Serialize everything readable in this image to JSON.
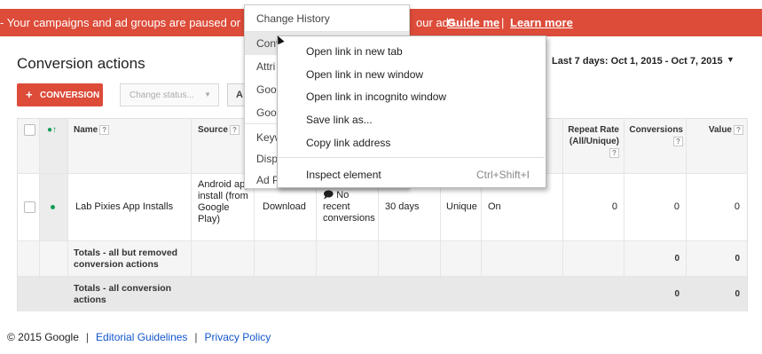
{
  "banner": {
    "text_left": "- Your campaigns and ad groups are paused or remov",
    "text_right": "our ads.",
    "guide_me": "Guide me",
    "separator": "|",
    "learn_more": "Learn more",
    "color": "#dd4b39"
  },
  "page": {
    "title": "Conversion actions",
    "date_range": "Last 7 days: Oct 1, 2015 - Oct 7, 2015",
    "date_icon": "caret-down-icon"
  },
  "toolbar": {
    "add_label": "CONVERSION",
    "add_icon": "+",
    "status_dropdown": "Change status...",
    "status_icon": "caret-down-icon",
    "partial_button": "A"
  },
  "table": {
    "headers": {
      "name": "Name",
      "source": "Source",
      "repeat_rate": "Repeat Rate (All/Unique)",
      "conversions": "Conversions",
      "value": "Value",
      "help": "?"
    },
    "rows": [
      {
        "name": "Lab Pixies App Installs",
        "source": "Android app install (from Google Play)",
        "category": "Download",
        "tracking_status": "No recent conversions",
        "status_icon": "comment-icon",
        "window": "30 days",
        "counting": "Unique",
        "include": "On",
        "repeat_rate": "0",
        "conversions": "0",
        "value": "0"
      }
    ],
    "totals": [
      {
        "label": "Totals - all but removed conversion actions",
        "conversions": "0",
        "value": "0"
      },
      {
        "label": "Totals - all conversion actions",
        "conversions": "0",
        "value": "0"
      }
    ]
  },
  "dropdown_menu": {
    "items": [
      "Change History",
      "Conv",
      "Attri",
      "Goog",
      "Goog",
      "Keyw",
      "Disp",
      "Ad P"
    ]
  },
  "context_menu": {
    "items": [
      {
        "label": "Open link in new tab"
      },
      {
        "label": "Open link in new window"
      },
      {
        "label": "Open link in incognito window"
      },
      {
        "label": "Save link as..."
      },
      {
        "label": "Copy link address"
      },
      {
        "label": "Inspect element",
        "shortcut": "Ctrl+Shift+I"
      }
    ]
  },
  "footer": {
    "copyright": "© 2015 Google",
    "editorial": "Editorial Guidelines",
    "privacy": "Privacy Policy",
    "separator": "|"
  }
}
